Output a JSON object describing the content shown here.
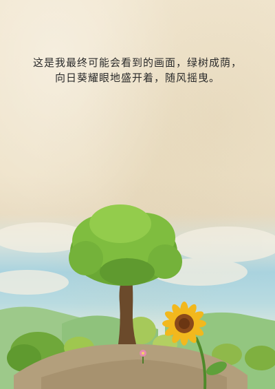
{
  "caption": {
    "line1": "这是我最终可能会看到的画面，绿树成荫，",
    "line2": "向日葵耀眼地盛开着，随风摇曳。"
  },
  "colors": {
    "paper": "#efe4cc",
    "sky": "#a9d3df",
    "hills": "#8cc07a",
    "foliage": "#7fbf3f",
    "trunk": "#6b4a2b",
    "sunflower_petal": "#f2b81d",
    "sunflower_center": "#8a4a1a",
    "ground": "#b9a27e"
  },
  "icons": {
    "tree": "tree-illustration",
    "sunflower": "sunflower-illustration",
    "flower": "small-pink-flower"
  }
}
